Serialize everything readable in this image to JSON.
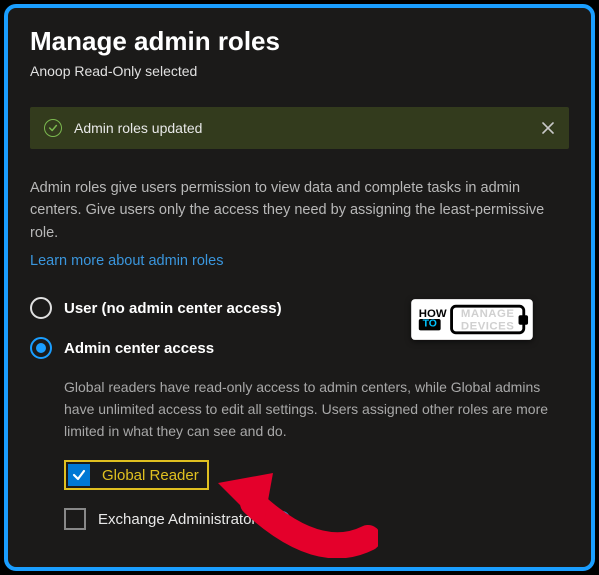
{
  "header": {
    "title": "Manage admin roles",
    "subtitle": "Anoop Read-Only selected"
  },
  "alert": {
    "message": "Admin roles updated"
  },
  "description": "Admin roles give users permission to view data and complete tasks in admin centers. Give users only the access they need by assigning the least-permissive role.",
  "learn_more": "Learn more about admin roles",
  "options": {
    "user_no_access": {
      "label": "User (no admin center access)",
      "selected": false
    },
    "admin_center_access": {
      "label": "Admin center access",
      "selected": true,
      "description": "Global readers have read-only access to admin centers, while Global admins have unlimited access to edit all settings. Users assigned other roles are more limited in what they can see and do."
    }
  },
  "roles": {
    "global_reader": {
      "label": "Global Reader",
      "checked": true
    },
    "exchange_admin": {
      "label": "Exchange Administrator",
      "checked": false
    }
  },
  "watermark": {
    "how": "HOW",
    "to": "TO",
    "line1": "MANAGE",
    "line2": "DEVICES"
  }
}
